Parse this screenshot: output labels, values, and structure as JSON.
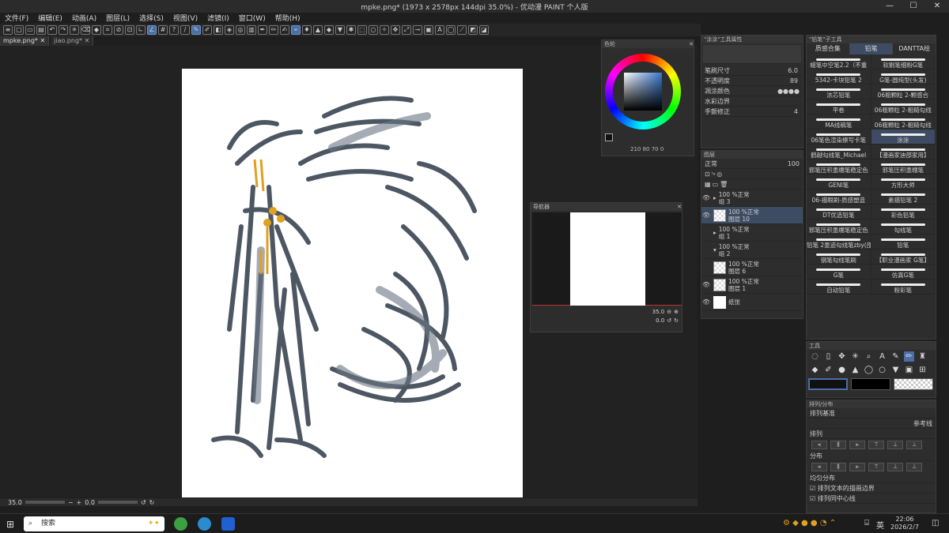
{
  "window": {
    "title": "mpke.png* (1973 x 2578px 144dpi 35.0%) - 优动漫 PAINT 个人版",
    "min": "—",
    "max": "☐",
    "close": "✕"
  },
  "menu": [
    "文件(F)",
    "编辑(E)",
    "动画(A)",
    "图层(L)",
    "选择(S)",
    "视图(V)",
    "滤镜(I)",
    "窗口(W)",
    "帮助(H)"
  ],
  "tabs": [
    {
      "label": "mpke.png*"
    },
    {
      "label": "jiao.png*"
    }
  ],
  "status": {
    "zoom": "35.0",
    "angle": "0.0"
  },
  "color_panel": {
    "title": "色轮",
    "values": "210   80   70   0"
  },
  "navigator": {
    "title": "导航器",
    "zoom": "35.0",
    "angle": "0.0"
  },
  "tool_property": {
    "title": "\"涂涂\"工具属性",
    "rows": [
      {
        "label": "笔刷尺寸",
        "value": "6.0"
      },
      {
        "label": "不透明度",
        "value": "89"
      },
      {
        "label": "凋涂颜色",
        "value": ""
      },
      {
        "label": "水彩边界",
        "value": ""
      },
      {
        "label": "手颤修正",
        "value": "4"
      }
    ]
  },
  "layers": {
    "title": "图层",
    "blend": "正常",
    "opacity": "100",
    "items": [
      {
        "pct": "100 %正常",
        "name": "组 3",
        "type": "folder",
        "sel": false
      },
      {
        "pct": "100 %正常",
        "name": "图层 10",
        "type": "layer",
        "sel": true
      },
      {
        "pct": "100 %正常",
        "name": "组 1",
        "type": "folder",
        "sel": false
      },
      {
        "pct": "100 %正常",
        "name": "组 2",
        "type": "folder",
        "sel": false
      },
      {
        "pct": "100 %正常",
        "name": "图层 6",
        "type": "layer",
        "sel": false
      },
      {
        "pct": "100 %正常",
        "name": "图层 1",
        "type": "layer",
        "sel": false
      },
      {
        "pct": "",
        "name": "纸张",
        "type": "paper",
        "sel": false
      }
    ]
  },
  "subtool": {
    "title": "\"铅笔\"子工具",
    "tabs": [
      "质感合集",
      "铅笔",
      "DANTTA绘"
    ],
    "brushes": [
      [
        "蜡笔中空笔2.2（不重",
        "软剔笔细粉G笔"
      ],
      [
        "5342-卡块铅笔 2",
        "G笔-圆纯型(头发)"
      ],
      [
        "浓芯铅笔",
        "06粗颗粒 2-颗感合"
      ],
      [
        "平卷",
        "06粗颗粒 2-粗糙勾线"
      ],
      [
        "MA线稿笔",
        "06粗颗粒 2-粗糙勾线"
      ],
      [
        "06笔色渲染擦写卡笔",
        "涂涂"
      ],
      [
        "鹤越勾线笔_Michael",
        "【漫画家迪邵家用】"
      ],
      [
        "邪笔压积墨绷笔稳定色",
        "邪笔压积墨绷笔"
      ],
      [
        "GENI笔",
        "方形大师"
      ],
      [
        "06-描眼刷-质感塑造",
        "素描铅笔 2"
      ],
      [
        "DT优选铅笔",
        "彩色铅笔"
      ],
      [
        "邪笔压积墨绷笔稳定色",
        "勾线笔"
      ],
      [
        "铅笔 2墨迹勾线笔zby(邵明",
        "铅笔"
      ],
      [
        "钢笔勾线笔刷",
        "【职业漫画家 G笔】"
      ],
      [
        "G笔",
        "仿真G笔"
      ],
      [
        "自动铅笔",
        "粉彩笔"
      ]
    ]
  },
  "tool_panel": {
    "title": "工具"
  },
  "align_panel": {
    "title": "排列/分布",
    "base_label": "排列基准",
    "ref": "参考线",
    "align_label": "排列",
    "dist_label": "分布",
    "even_label": "均匀分布",
    "check1": "排列文本的描画边界",
    "check2": "排列同中心线"
  },
  "taskbar": {
    "search": "搜索",
    "ime": "英",
    "time": "22:06",
    "date": "2026/2/7"
  }
}
